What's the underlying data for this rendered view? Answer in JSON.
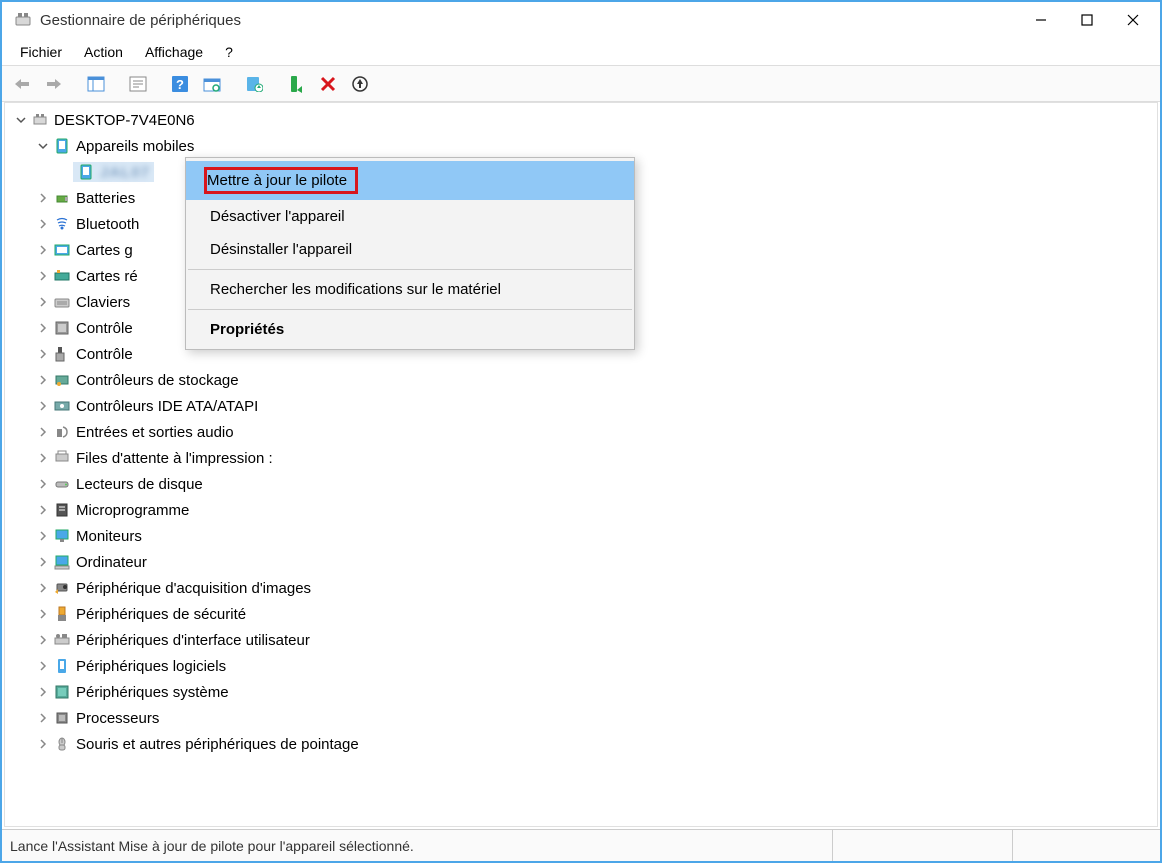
{
  "window": {
    "title": "Gestionnaire de périphériques"
  },
  "menu": {
    "file": "Fichier",
    "action": "Action",
    "view": "Affichage",
    "help": "?"
  },
  "tree": {
    "root": "DESKTOP-7V4E0N6",
    "cat_mobile": "Appareils mobiles",
    "device_blurred": "JAL07",
    "items": [
      "Batteries",
      "Bluetooth",
      "Cartes g",
      "Cartes ré",
      "Claviers",
      "Contrôle",
      "Contrôle",
      "Contrôleurs de stockage",
      "Contrôleurs IDE ATA/ATAPI",
      "Entrées et sorties audio",
      "Files d'attente à l'impression :",
      "Lecteurs de disque",
      "Microprogramme",
      "Moniteurs",
      "Ordinateur",
      "Périphérique d'acquisition d'images",
      "Périphériques de sécurité",
      "Périphériques d'interface utilisateur",
      "Périphériques logiciels",
      "Périphériques système",
      "Processeurs",
      "Souris et autres périphériques de pointage"
    ]
  },
  "context_menu": {
    "update": "Mettre à jour le pilote",
    "disable": "Désactiver l'appareil",
    "uninstall": "Désinstaller l'appareil",
    "scan": "Rechercher les modifications sur le matériel",
    "props": "Propriétés"
  },
  "statusbar": {
    "text": "Lance l'Assistant Mise à jour de pilote pour l'appareil sélectionné."
  }
}
